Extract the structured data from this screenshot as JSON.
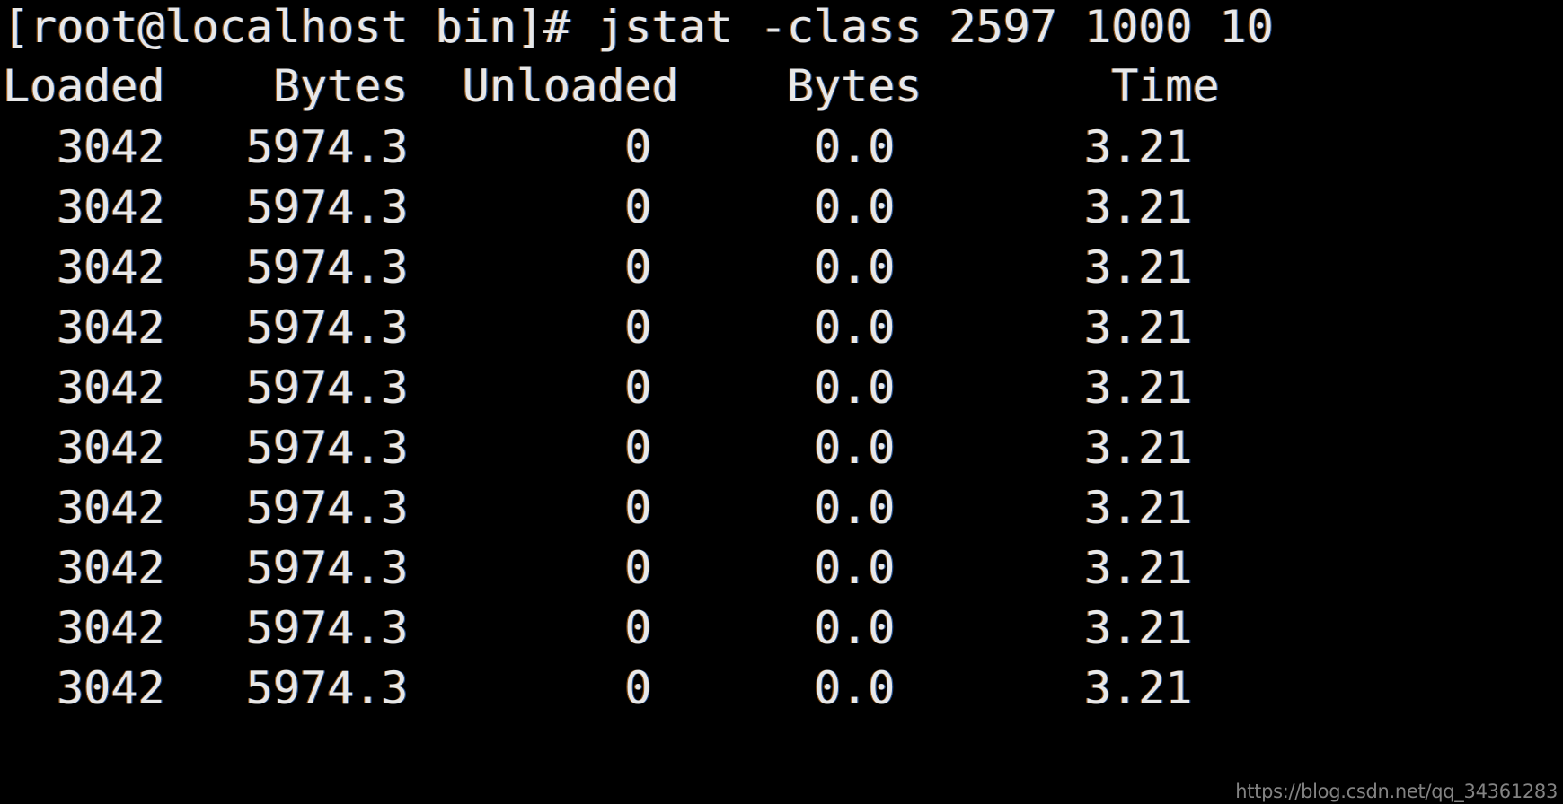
{
  "terminal": {
    "background_color": "#000000",
    "foreground_color": "#e8e8e8",
    "prompt_line": "[root@localhost bin]# jstat -class 2597 1000 10",
    "prompt": {
      "user": "root",
      "host": "localhost",
      "directory": "bin",
      "symbol": "#",
      "text": "[root@localhost bin]#"
    },
    "command": {
      "text": "jstat -class 2597 1000 10",
      "program": "jstat",
      "option": "-class",
      "pid": "2597",
      "interval_ms": "1000",
      "count": "10"
    },
    "header_line": "Loaded    Bytes  Unloaded    Bytes       Time",
    "columns": [
      "Loaded",
      "Bytes",
      "Unloaded",
      "Bytes",
      "Time"
    ],
    "rows": [
      {
        "line": "  3042   5974.3        0      0.0       3.21",
        "Loaded": "3042",
        "Bytes": "5974.3",
        "Unloaded": "0",
        "UnloadedBytes": "0.0",
        "Time": "3.21"
      },
      {
        "line": "  3042   5974.3        0      0.0       3.21",
        "Loaded": "3042",
        "Bytes": "5974.3",
        "Unloaded": "0",
        "UnloadedBytes": "0.0",
        "Time": "3.21"
      },
      {
        "line": "  3042   5974.3        0      0.0       3.21",
        "Loaded": "3042",
        "Bytes": "5974.3",
        "Unloaded": "0",
        "UnloadedBytes": "0.0",
        "Time": "3.21"
      },
      {
        "line": "  3042   5974.3        0      0.0       3.21",
        "Loaded": "3042",
        "Bytes": "5974.3",
        "Unloaded": "0",
        "UnloadedBytes": "0.0",
        "Time": "3.21"
      },
      {
        "line": "  3042   5974.3        0      0.0       3.21",
        "Loaded": "3042",
        "Bytes": "5974.3",
        "Unloaded": "0",
        "UnloadedBytes": "0.0",
        "Time": "3.21"
      },
      {
        "line": "  3042   5974.3        0      0.0       3.21",
        "Loaded": "3042",
        "Bytes": "5974.3",
        "Unloaded": "0",
        "UnloadedBytes": "0.0",
        "Time": "3.21"
      },
      {
        "line": "  3042   5974.3        0      0.0       3.21",
        "Loaded": "3042",
        "Bytes": "5974.3",
        "Unloaded": "0",
        "UnloadedBytes": "0.0",
        "Time": "3.21"
      },
      {
        "line": "  3042   5974.3        0      0.0       3.21",
        "Loaded": "3042",
        "Bytes": "5974.3",
        "Unloaded": "0",
        "UnloadedBytes": "0.0",
        "Time": "3.21"
      },
      {
        "line": "  3042   5974.3        0      0.0       3.21",
        "Loaded": "3042",
        "Bytes": "5974.3",
        "Unloaded": "0",
        "UnloadedBytes": "0.0",
        "Time": "3.21"
      },
      {
        "line": "  3042   5974.3        0      0.0       3.21",
        "Loaded": "3042",
        "Bytes": "5974.3",
        "Unloaded": "0",
        "UnloadedBytes": "0.0",
        "Time": "3.21"
      }
    ]
  },
  "watermark": {
    "text": "https://blog.csdn.net/qq_34361283"
  }
}
